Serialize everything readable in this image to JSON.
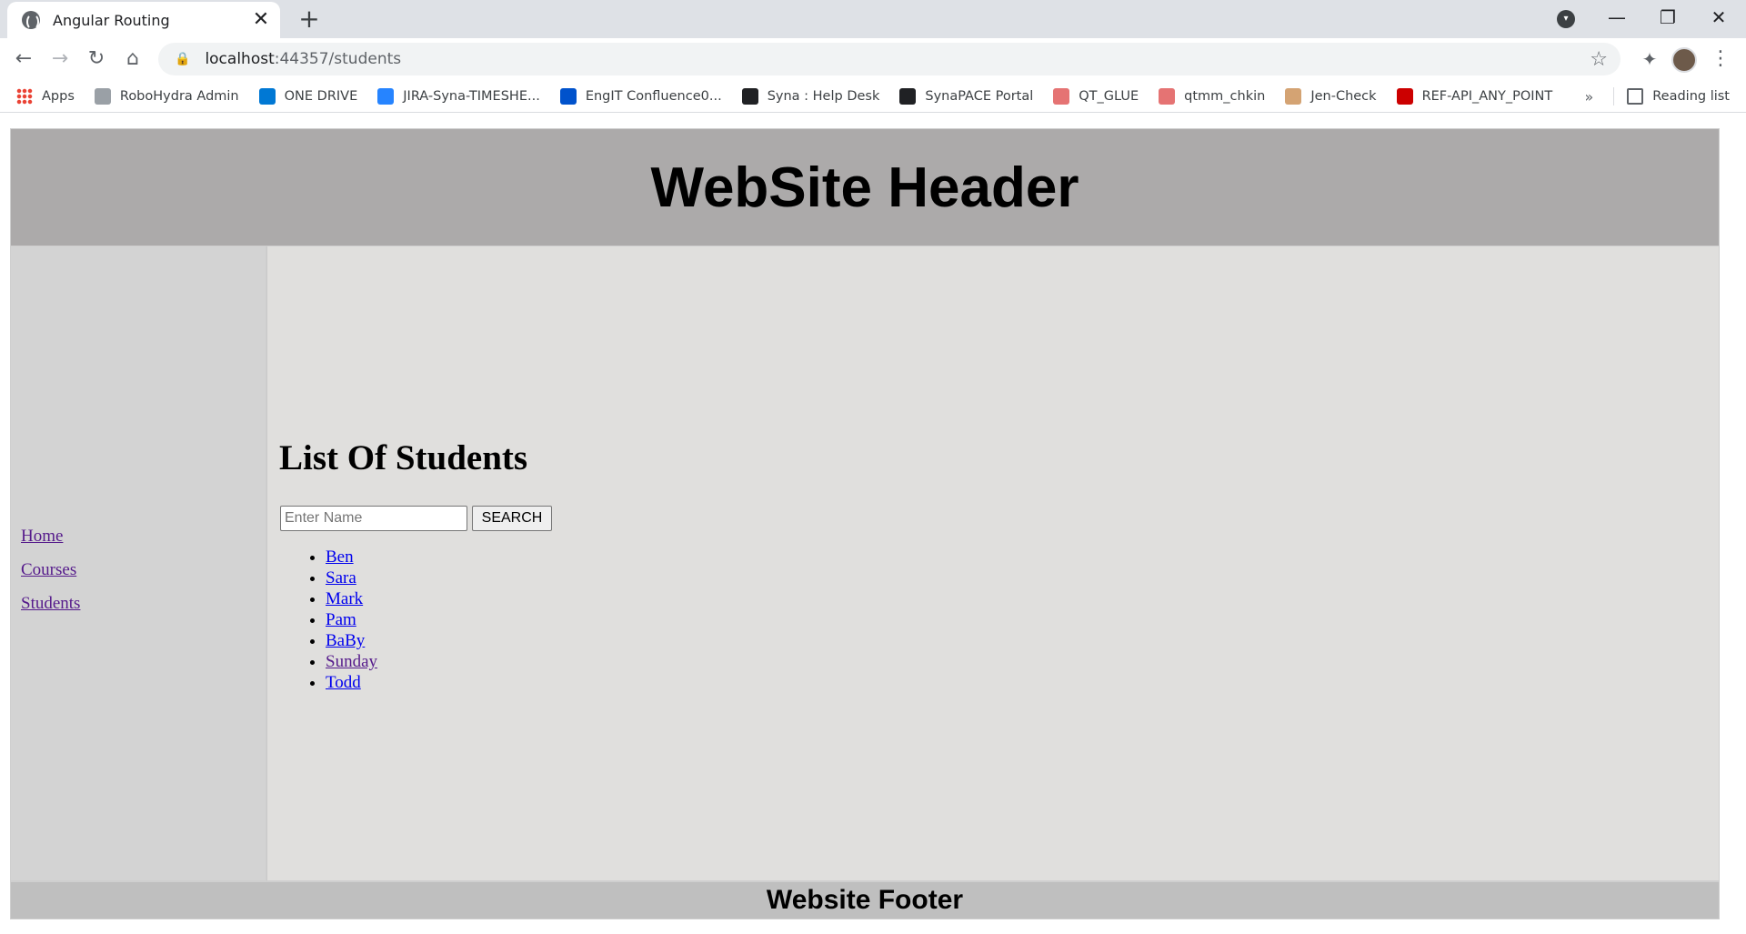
{
  "browser": {
    "tab_title": "Angular Routing",
    "tab_close": "✕",
    "new_tab": "+",
    "window_controls": {
      "minimize": "—",
      "restore": "❐",
      "close": "✕"
    },
    "url_host": "localhost",
    "url_path": ":44357/students",
    "bookmarks": [
      {
        "label": "Apps",
        "icon": "apps-grid-icon",
        "color": "#ea4335"
      },
      {
        "label": "RoboHydra Admin",
        "icon": "robohydra-icon",
        "color": "#9aa0a6"
      },
      {
        "label": "ONE DRIVE",
        "icon": "cloud-icon",
        "color": "#0078d4"
      },
      {
        "label": "JIRA-Syna-TIMESHE...",
        "icon": "jira-icon",
        "color": "#2684ff"
      },
      {
        "label": "EngIT Confluence0...",
        "icon": "confluence-icon",
        "color": "#0052cc"
      },
      {
        "label": "Syna : Help Desk",
        "icon": "syna-icon",
        "color": "#202124"
      },
      {
        "label": "SynaPACE Portal",
        "icon": "syna-icon",
        "color": "#202124"
      },
      {
        "label": "QT_GLUE",
        "icon": "qt-icon",
        "color": "#e57373"
      },
      {
        "label": "qtmm_chkin",
        "icon": "qt-icon",
        "color": "#e57373"
      },
      {
        "label": "Jen-Check",
        "icon": "jenkins-icon",
        "color": "#d4a373"
      },
      {
        "label": "REF-API_ANY_POINT",
        "icon": "cisco-icon",
        "color": "#cc0000"
      }
    ],
    "bookmarks_more": "»",
    "reading_list": "Reading list"
  },
  "page": {
    "header_title": "WebSite Header",
    "nav": [
      "Home",
      "Courses",
      "Students"
    ],
    "heading": "List Of Students",
    "search_placeholder": "Enter Name",
    "search_button": "SEARCH",
    "students": [
      "Ben",
      "Sara",
      "Mark",
      "Pam",
      "BaBy",
      "Sunday",
      "Todd"
    ],
    "footer_title": "Website Footer"
  },
  "colors": {
    "header_bg": "#acaaaa",
    "sidebar_bg": "#d3d3d3",
    "main_bg": "#e0dfdd",
    "footer_bg": "#bfbfbf",
    "link": "#0000ee",
    "visited_link": "#551a8b"
  }
}
